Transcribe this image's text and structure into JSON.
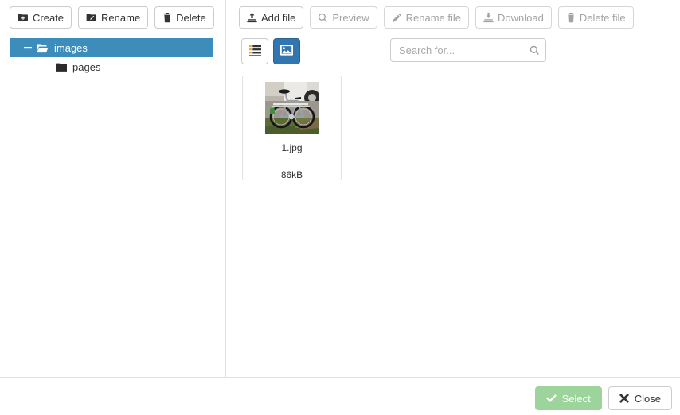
{
  "colors": {
    "tree_selected_bg": "#3c8dbc",
    "view_active_bg": "#3276b1",
    "select_button_bg": "#9cd49c",
    "border": "#cccccc",
    "divider": "#e0e0e0"
  },
  "folder_toolbar": {
    "buttons": [
      {
        "label": "Create",
        "icon": "folder-plus-icon",
        "disabled": false
      },
      {
        "label": "Rename",
        "icon": "folder-pencil-icon",
        "disabled": false
      },
      {
        "label": "Delete",
        "icon": "trash-icon",
        "disabled": false
      }
    ]
  },
  "tree": {
    "nodes": [
      {
        "label": "images",
        "icon": "folder-open-icon",
        "toggle": "minus",
        "selected": true,
        "level": 0
      },
      {
        "label": "pages",
        "icon": "folder-closed-icon",
        "toggle": "",
        "selected": false,
        "level": 1
      }
    ]
  },
  "file_toolbar": {
    "buttons": [
      {
        "label": "Add file",
        "icon": "upload-icon",
        "disabled": false
      },
      {
        "label": "Preview",
        "icon": "search-icon",
        "disabled": true
      },
      {
        "label": "Rename file",
        "icon": "pencil-icon",
        "disabled": true
      },
      {
        "label": "Download",
        "icon": "download-icon",
        "disabled": true
      },
      {
        "label": "Delete file",
        "icon": "trash-icon",
        "disabled": true
      }
    ]
  },
  "view_toggle": {
    "list": {
      "icon": "list-view-icon",
      "active": false
    },
    "grid": {
      "icon": "image-view-icon",
      "active": true
    }
  },
  "search": {
    "placeholder": "Search for...",
    "value": "",
    "icon": "search-icon"
  },
  "files": [
    {
      "name": "1.jpg",
      "size": "86kB",
      "thumbnail": "bicycle-photo"
    }
  ],
  "footer": {
    "select_label": "Select",
    "select_icon": "check-icon",
    "select_disabled": true,
    "close_label": "Close",
    "close_icon": "close-icon"
  }
}
